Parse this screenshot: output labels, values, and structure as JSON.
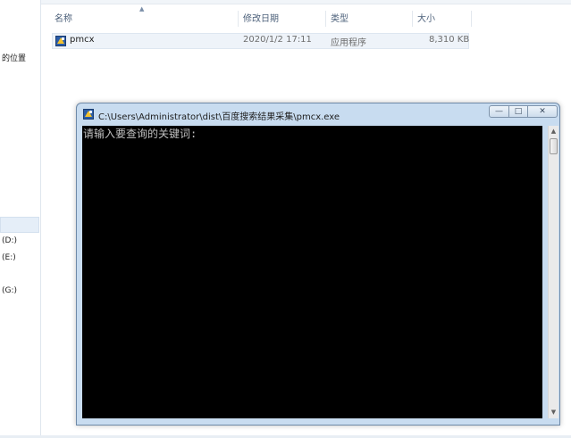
{
  "explorer": {
    "nav": {
      "items": [
        {
          "label": "的位置"
        },
        {
          "label": "(D:)"
        },
        {
          "label": "(E:)"
        },
        {
          "label": "(G:)"
        }
      ]
    },
    "columns": {
      "name": "名称",
      "modified": "修改日期",
      "type": "类型",
      "size": "大小"
    },
    "files": [
      {
        "name": "pmcx",
        "modified": "2020/1/2 17:11",
        "type": "应用程序",
        "size": "8,310 KB",
        "icon": "exe-icon"
      }
    ]
  },
  "console": {
    "title": "C:\\Users\\Administrator\\dist\\百度搜索结果采集\\pmcx.exe",
    "output": "请输入要查询的关键词:",
    "buttons": {
      "minimize": "—",
      "maximize": "□",
      "close": "✕"
    }
  },
  "colors": {
    "console_bg": "#000000",
    "console_text": "#c0c0c0",
    "titlebar": "#c8dcf0"
  }
}
